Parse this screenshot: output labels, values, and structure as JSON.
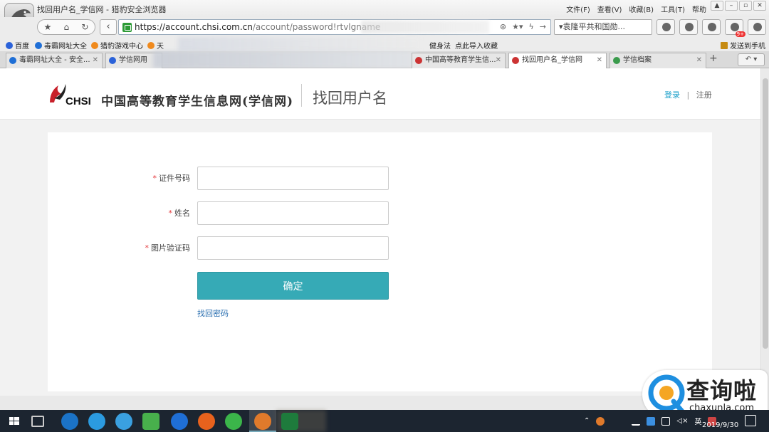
{
  "window": {
    "title": "找回用户名_学信网 - 猎豹安全浏览器",
    "menu": [
      "文件(F)",
      "查看(V)",
      "收藏(B)",
      "工具(T)",
      "帮助"
    ]
  },
  "navbar": {
    "address_host": "https://account.chsi.com.cn",
    "address_path": "/account/password!rtvlgname",
    "search_text": "▾袁隆平共和国勋...",
    "ext_badge": "9+"
  },
  "bookmarks": [
    {
      "label": "百度",
      "color": "#2b62d9"
    },
    {
      "label": "毒霸网址大全",
      "color": "#1f6fd6"
    },
    {
      "label": "猎豹游戏中心",
      "color": "#f08a1d"
    },
    {
      "label": "天",
      "color": "#f08a1d"
    },
    {
      "label": "健身法",
      "color": ""
    },
    {
      "label": "点此导入收藏",
      "color": ""
    },
    {
      "label": "发送到手机",
      "color": "#c68b12"
    }
  ],
  "tabs": [
    {
      "label": "毒霸网址大全 - 安全...",
      "color": "#1f6fd6",
      "active": false
    },
    {
      "label": "学信网用",
      "color": "#2b62d9",
      "active": false
    },
    {
      "label": "中国高等教育学生信...",
      "color": "#c33",
      "active": false
    },
    {
      "label": "找回用户名_学信网",
      "color": "#c33",
      "active": true
    },
    {
      "label": "学信档案",
      "color": "#3a9b4c",
      "active": false
    }
  ],
  "header": {
    "logo_text": "CHSI",
    "brand": "中国高等教育学生信息网(学信网)",
    "title": "找回用户名",
    "login": "登录",
    "separator": "|",
    "register": "注册"
  },
  "form": {
    "fields": [
      {
        "required": "*",
        "label": "证件号码",
        "value": ""
      },
      {
        "required": "*",
        "label": "姓名",
        "value": ""
      },
      {
        "required": "*",
        "label": "图片验证码",
        "value": ""
      }
    ],
    "submit": "确定",
    "forgot_password": "找回密码"
  },
  "watermark": {
    "cn": "查询啦",
    "en": "chaxunla.com"
  },
  "taskbar": {
    "ime": "英",
    "date": "2019/9/30"
  },
  "colors": {
    "accent": "#36aab6",
    "link": "#1a9fc9",
    "required": "#e4393c"
  }
}
